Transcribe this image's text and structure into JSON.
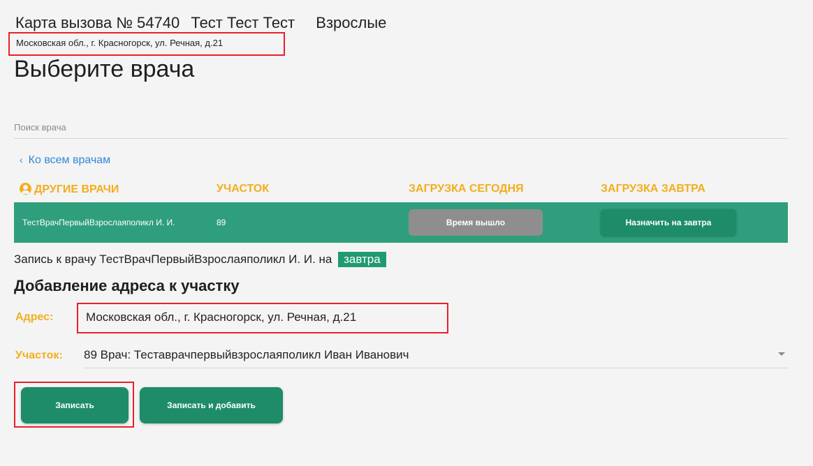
{
  "header": {
    "card_title": "Карта вызова № 54740",
    "patient_name": "Тест Тест Тест",
    "category": "Взрослые",
    "address": "Московская обл., г. Красногорск, ул. Речная, д.21"
  },
  "page_title": "Выберите врача",
  "search": {
    "placeholder": "Поиск врача",
    "value": ""
  },
  "back_link": "Ко всем врачам",
  "table": {
    "headers": [
      "ДРУГИЕ ВРАЧИ",
      "УЧАСТОК",
      "ЗАГРУЗКА СЕГОДНЯ",
      "ЗАГРУЗКА ЗАВТРА"
    ],
    "rows": [
      {
        "doctor": "ТестВрачПервыйВзрослаяполикл И. И.",
        "plot": "89",
        "today_button": "Время вышло",
        "tomorrow_button": "Назначить на завтра"
      }
    ]
  },
  "appointment": {
    "text": "Запись к врачу ТестВрачПервыйВзрослаяполикл И. И. на",
    "day": "завтра"
  },
  "address_section": {
    "title": "Добавление адреса к участку",
    "address_label": "Адрес:",
    "address_value": "Московская обл., г. Красногорск, ул. Речная, д.21",
    "plot_label": "Участок:",
    "plot_value": "89 Врач: Теставрачпервыйвзрослаяполикл Иван Иванович"
  },
  "buttons": {
    "save": "Записать",
    "save_and_add": "Записать и добавить"
  },
  "colors": {
    "accent_green": "#1e8c68",
    "row_green": "#2f9e7c",
    "header_orange": "#f2ae1c",
    "link_blue": "#2f88d8",
    "highlight_red": "#e8202a",
    "disabled_gray": "#8e8e8e"
  }
}
